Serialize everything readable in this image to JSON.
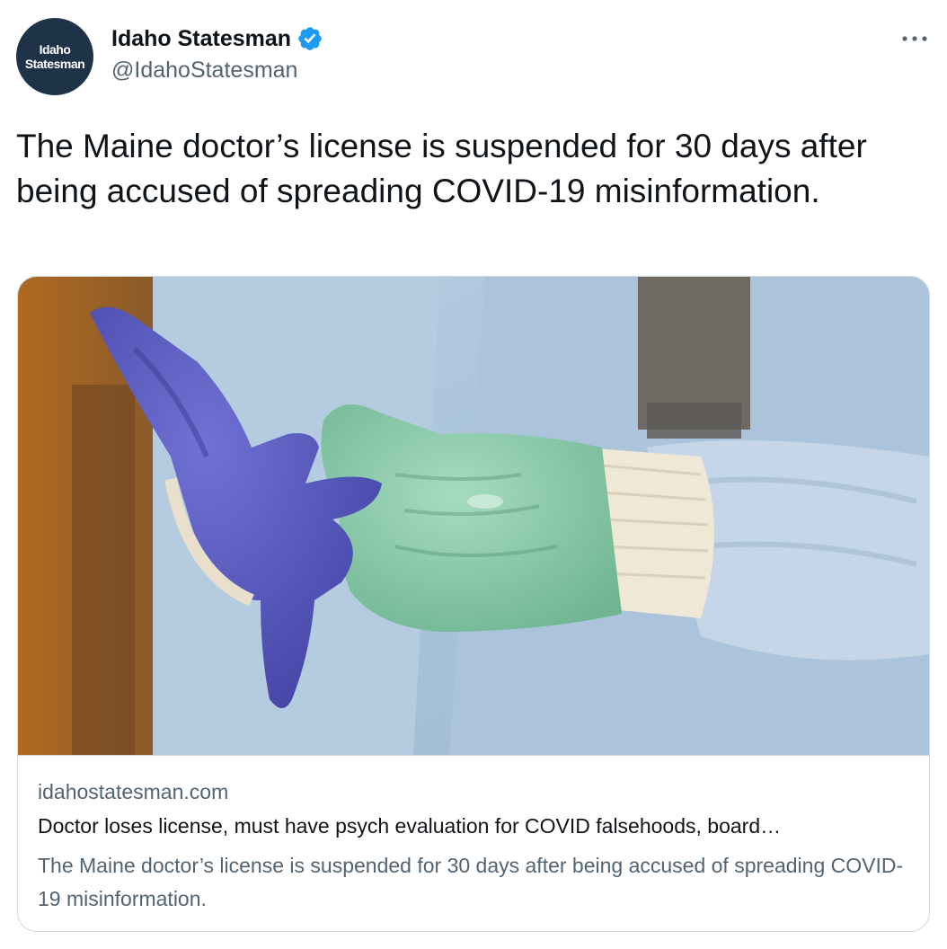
{
  "tweet": {
    "author": {
      "avatar_line1": "Idaho",
      "avatar_line2": "Statesman",
      "display_name": "Idaho Statesman",
      "handle": "@IdahoStatesman",
      "verified": true
    },
    "text": "The Maine doctor’s license is suspended for 30 days after being accused of spreading COVID-19 misinformation.",
    "card": {
      "domain": "idahostatesman.com",
      "title": "Doctor loses license, must have psych evaluation for COVID falsehoods, board…",
      "description": "The Maine doctor’s license is suspended for 30 days after being accused of spreading COVID-19 misinformation."
    }
  },
  "colors": {
    "text_primary": "#0f1419",
    "text_secondary": "#536471",
    "verified_blue": "#1d9bf0",
    "avatar_bg": "#1e3347",
    "card_border": "#cfd9de"
  },
  "icons": {
    "verified": "verified-badge-icon",
    "more": "more-options-icon"
  }
}
